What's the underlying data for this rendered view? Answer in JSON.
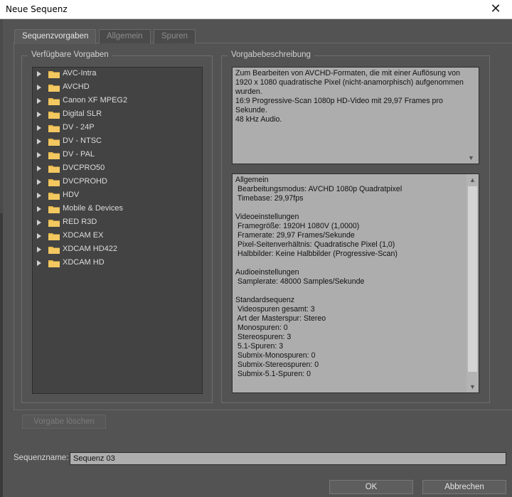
{
  "window": {
    "title": "Neue Sequenz",
    "close_glyph": "✕"
  },
  "tabs": [
    {
      "label": "Sequenzvorgaben",
      "active": true
    },
    {
      "label": "Allgemein",
      "active": false
    },
    {
      "label": "Spuren",
      "active": false
    }
  ],
  "presets": {
    "group_label": "Verfügbare Vorgaben",
    "items": [
      "AVC-Intra",
      "AVCHD",
      "Canon XF MPEG2",
      "Digital SLR",
      "DV - 24P",
      "DV - NTSC",
      "DV - PAL",
      "DVCPRO50",
      "DVCPROHD",
      "HDV",
      "Mobile & Devices",
      "RED R3D",
      "XDCAM EX",
      "XDCAM HD422",
      "XDCAM HD"
    ],
    "folder_color": "#e8b84a"
  },
  "description": {
    "group_label": "Vorgabebeschreibung",
    "text": "Zum Bearbeiten von AVCHD-Formaten, die mit einer Auflösung von 1920 x 1080 quadratische Pixel (nicht-anamorphisch) aufgenommen wurden.\n16:9 Progressive-Scan 1080p HD-Video mit 29,97 Frames pro Sekunde.\n48 kHz Audio."
  },
  "details": [
    "Allgemein",
    " Bearbeitungsmodus: AVCHD 1080p Quadratpixel",
    " Timebase: 29,97fps",
    "",
    "Videoeinstellungen",
    " Framegröße: 1920H 1080V (1,0000)",
    " Framerate: 29,97 Frames/Sekunde",
    " Pixel-Seitenverhältnis: Quadratische Pixel (1,0)",
    " Halbbilder: Keine Halbbilder (Progressive-Scan)",
    "",
    "Audioeinstellungen",
    " Samplerate: 48000 Samples/Sekunde",
    "",
    "Standardsequenz",
    " Videospuren gesamt: 3",
    " Art der Masterspur: Stereo",
    " Monospuren: 0",
    " Stereospuren: 3",
    " 5.1-Spuren: 3",
    " Submix-Monospuren: 0",
    " Submix-Stereospuren: 0",
    " Submix-5.1-Spuren: 0"
  ],
  "buttons": {
    "delete_preset": "Vorgabe löschen",
    "ok": "OK",
    "cancel": "Abbrechen"
  },
  "sequence_name": {
    "label": "Sequenzname:",
    "value": "Sequenz 03"
  }
}
